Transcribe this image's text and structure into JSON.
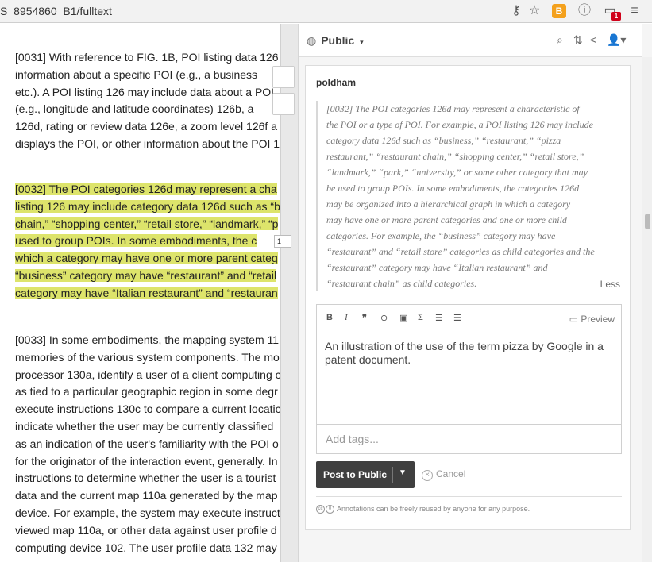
{
  "browser": {
    "url": "S_8954860_B1/fulltext",
    "ext_badge": "1"
  },
  "document": {
    "para31": [
      "[0031] With reference to FIG. 1B, POI listing data 126",
      "information about a specific POI (e.g., a business",
      "etc.). A POI listing 126 may include data about a POI",
      "(e.g., longitude and latitude coordinates) 126b, a",
      "126d, rating or review data 126e, a zoom level 126f a",
      "displays the POI, or other information about the POI 1"
    ],
    "para32": [
      "[0032] The POI categories 126d may represent a cha",
      "listing 126 may include category data 126d such as “b",
      "chain,” “shopping center,” “retail store,” “landmark,” “p",
      "used to group POIs. In some embodiments, the c",
      "which a category may have one or more parent categ",
      "“business” category may have “restaurant” and “retail",
      "category may have “Italian restaurant” and “restauran"
    ],
    "para33": [
      "[0033] In some embodiments, the mapping system 11",
      "memories of the various system components. The mo",
      "processor 130a, identify a user of a client computing c",
      "as tied to a particular geographic region in some degr",
      "execute instructions 130c to compare a current locatic",
      "indicate whether the user may be currently classified",
      "as an indication of the user's familiarity with the POI o",
      "for the originator of the interaction event, generally. In",
      "instructions to determine whether the user is a tourist",
      "data and the current map 110a generated by the map",
      "device. For example, the system may execute instruct",
      "viewed map 110a, or other data against user profile d",
      "computing device 102. The user profile data 132 may"
    ],
    "gutter_count": "1"
  },
  "sidebar": {
    "group_label": "Public",
    "username": "poldham",
    "quote": [
      "[0032] The POI categories 126d may represent a characteristic of",
      "the POI or a type of POI. For example, a POI listing 126 may include",
      "category data 126d such as “business,” “restaurant,” “pizza",
      "restaurant,” “restaurant chain,” “shopping center,” “retail store,”",
      "“landmark,” “park,” “university,” or some other category that may",
      "be used to group POIs. In some embodiments, the categories 126d",
      "may be organized into a hierarchical graph in which a category",
      "may have one or more parent categories and one or more child",
      "categories. For example, the “business” category may have",
      "“restaurant” and “retail store” categories as child categories and the",
      "“restaurant” category may have “Italian restaurant” and",
      "“restaurant chain” as child categories."
    ],
    "less_label": "Less",
    "preview_label": "Preview",
    "annotation_text": "An illustration of the use of the term pizza by Google in a patent document.",
    "tags_placeholder": "Add tags...",
    "post_label": "Post to Public",
    "cancel_label": "Cancel",
    "license_text": "Annotations can be freely reused by anyone for any purpose."
  }
}
